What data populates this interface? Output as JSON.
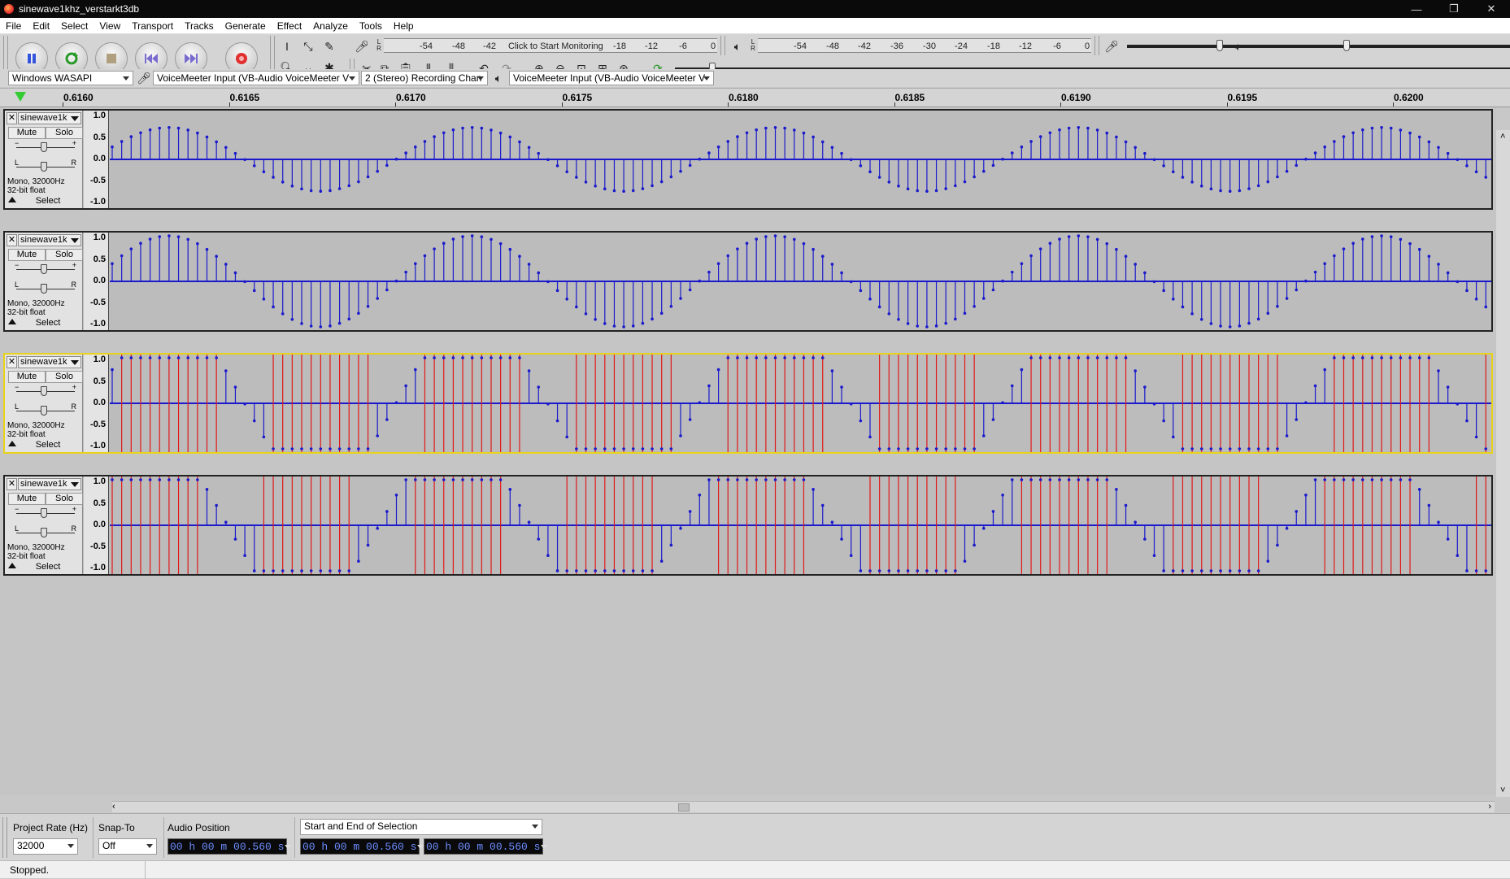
{
  "window": {
    "title": "sinewave1khz_verstarkt3db",
    "min": "—",
    "max": "❐",
    "close": "✕"
  },
  "menu": [
    "File",
    "Edit",
    "Select",
    "View",
    "Transport",
    "Tracks",
    "Generate",
    "Effect",
    "Analyze",
    "Tools",
    "Help"
  ],
  "transport": {
    "pause": "pause",
    "loop": "loop",
    "stop": "stop",
    "skip_start": "skip-to-start",
    "skip_end": "skip-to-end",
    "record": "record"
  },
  "meters": {
    "record_ticks": [
      "-54",
      "-48",
      "-42",
      "-18",
      "-12",
      "-6",
      "0"
    ],
    "record_prompt": "Click to Start Monitoring",
    "play_ticks": [
      "-54",
      "-48",
      "-42",
      "-36",
      "-30",
      "-24",
      "-18",
      "-12",
      "-6",
      "0"
    ]
  },
  "device": {
    "host": "Windows WASAPI",
    "rec_device": "VoiceMeeter Input (VB-Audio VoiceMeeter V",
    "channels": "2 (Stereo) Recording Chan",
    "play_device": "VoiceMeeter Input (VB-Audio VoiceMeeter V"
  },
  "ruler": {
    "ticks": [
      "0.6160",
      "0.6165",
      "0.6170",
      "0.6175",
      "0.6180",
      "0.6185",
      "0.6190",
      "0.6195",
      "0.6200"
    ]
  },
  "tracks": [
    {
      "name": "sinewave1k",
      "mute": "Mute",
      "solo": "Solo",
      "info1": "Mono, 32000Hz",
      "info2": "32-bit float",
      "select": "Select",
      "amplitude": 0.7,
      "clipped": false,
      "selected": false,
      "phase": 0.0
    },
    {
      "name": "sinewave1k",
      "mute": "Mute",
      "solo": "Solo",
      "info1": "Mono, 32000Hz",
      "info2": "32-bit float",
      "select": "Select",
      "amplitude": 1.0,
      "clipped": false,
      "selected": false,
      "phase": 0.0
    },
    {
      "name": "sinewave1k",
      "mute": "Mute",
      "solo": "Solo",
      "info1": "Mono, 32000Hz",
      "info2": "32-bit float",
      "select": "Select",
      "amplitude": 1.0,
      "clipped": true,
      "selected": true,
      "phase": 0.0
    },
    {
      "name": "sinewave1k",
      "mute": "Mute",
      "solo": "Solo",
      "info1": "Mono, 32000Hz",
      "info2": "32-bit float",
      "select": "Select",
      "amplitude": 1.0,
      "clipped": true,
      "selected": false,
      "phase": 0.35
    }
  ],
  "vruler_labels": [
    "1.0",
    "0.5",
    "0.0",
    "-0.5",
    "-1.0"
  ],
  "colors": {
    "wave": "#1a1acc",
    "clip": "#e01818",
    "selected_border": "#e8d21a"
  },
  "bottom": {
    "rate_label": "Project Rate (Hz)",
    "rate_value": "32000",
    "snap_label": "Snap-To",
    "snap_value": "Off",
    "position_label": "Audio Position",
    "selection_mode": "Start and End of Selection",
    "position_value": "00 h 00 m 00.560 s",
    "sel_start": "00 h 00 m 00.560 s",
    "sel_end": "00 h 00 m 00.560 s"
  },
  "status": "Stopped."
}
